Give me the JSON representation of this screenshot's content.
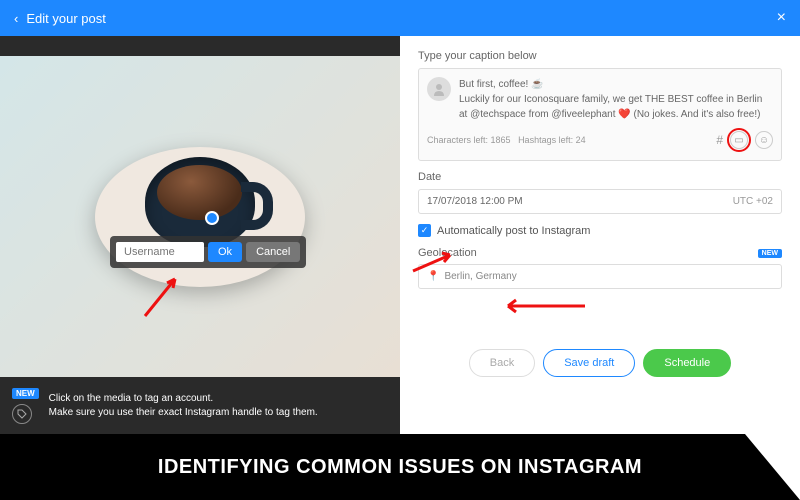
{
  "header": {
    "title": "Edit your post"
  },
  "tag": {
    "placeholder": "Username",
    "ok": "Ok",
    "cancel": "Cancel"
  },
  "hint": {
    "new": "NEW",
    "line1": "Click on the media to tag an account.",
    "line2": "Make sure you use their exact Instagram handle to tag them."
  },
  "caption": {
    "label": "Type your caption below",
    "text": "But first, coffee! ☕\nLuckily for our Iconosquare family, we get THE BEST coffee in Berlin at @techspace from @fiveelephant ❤️ (No jokes. And it's also free!)",
    "chars": "Characters left: 1865",
    "hashtags": "Hashtags left: 24",
    "hash": "#"
  },
  "date": {
    "label": "Date",
    "value": "17/07/2018 12:00 PM",
    "utc": "UTC +02"
  },
  "auto": {
    "label": "Automatically post to Instagram"
  },
  "geo": {
    "label": "Geolocation",
    "new": "NEW",
    "value": "Berlin, Germany"
  },
  "buttons": {
    "back": "Back",
    "draft": "Save draft",
    "schedule": "Schedule"
  },
  "banner": "IDENTIFYING COMMON ISSUES ON INSTAGRAM"
}
